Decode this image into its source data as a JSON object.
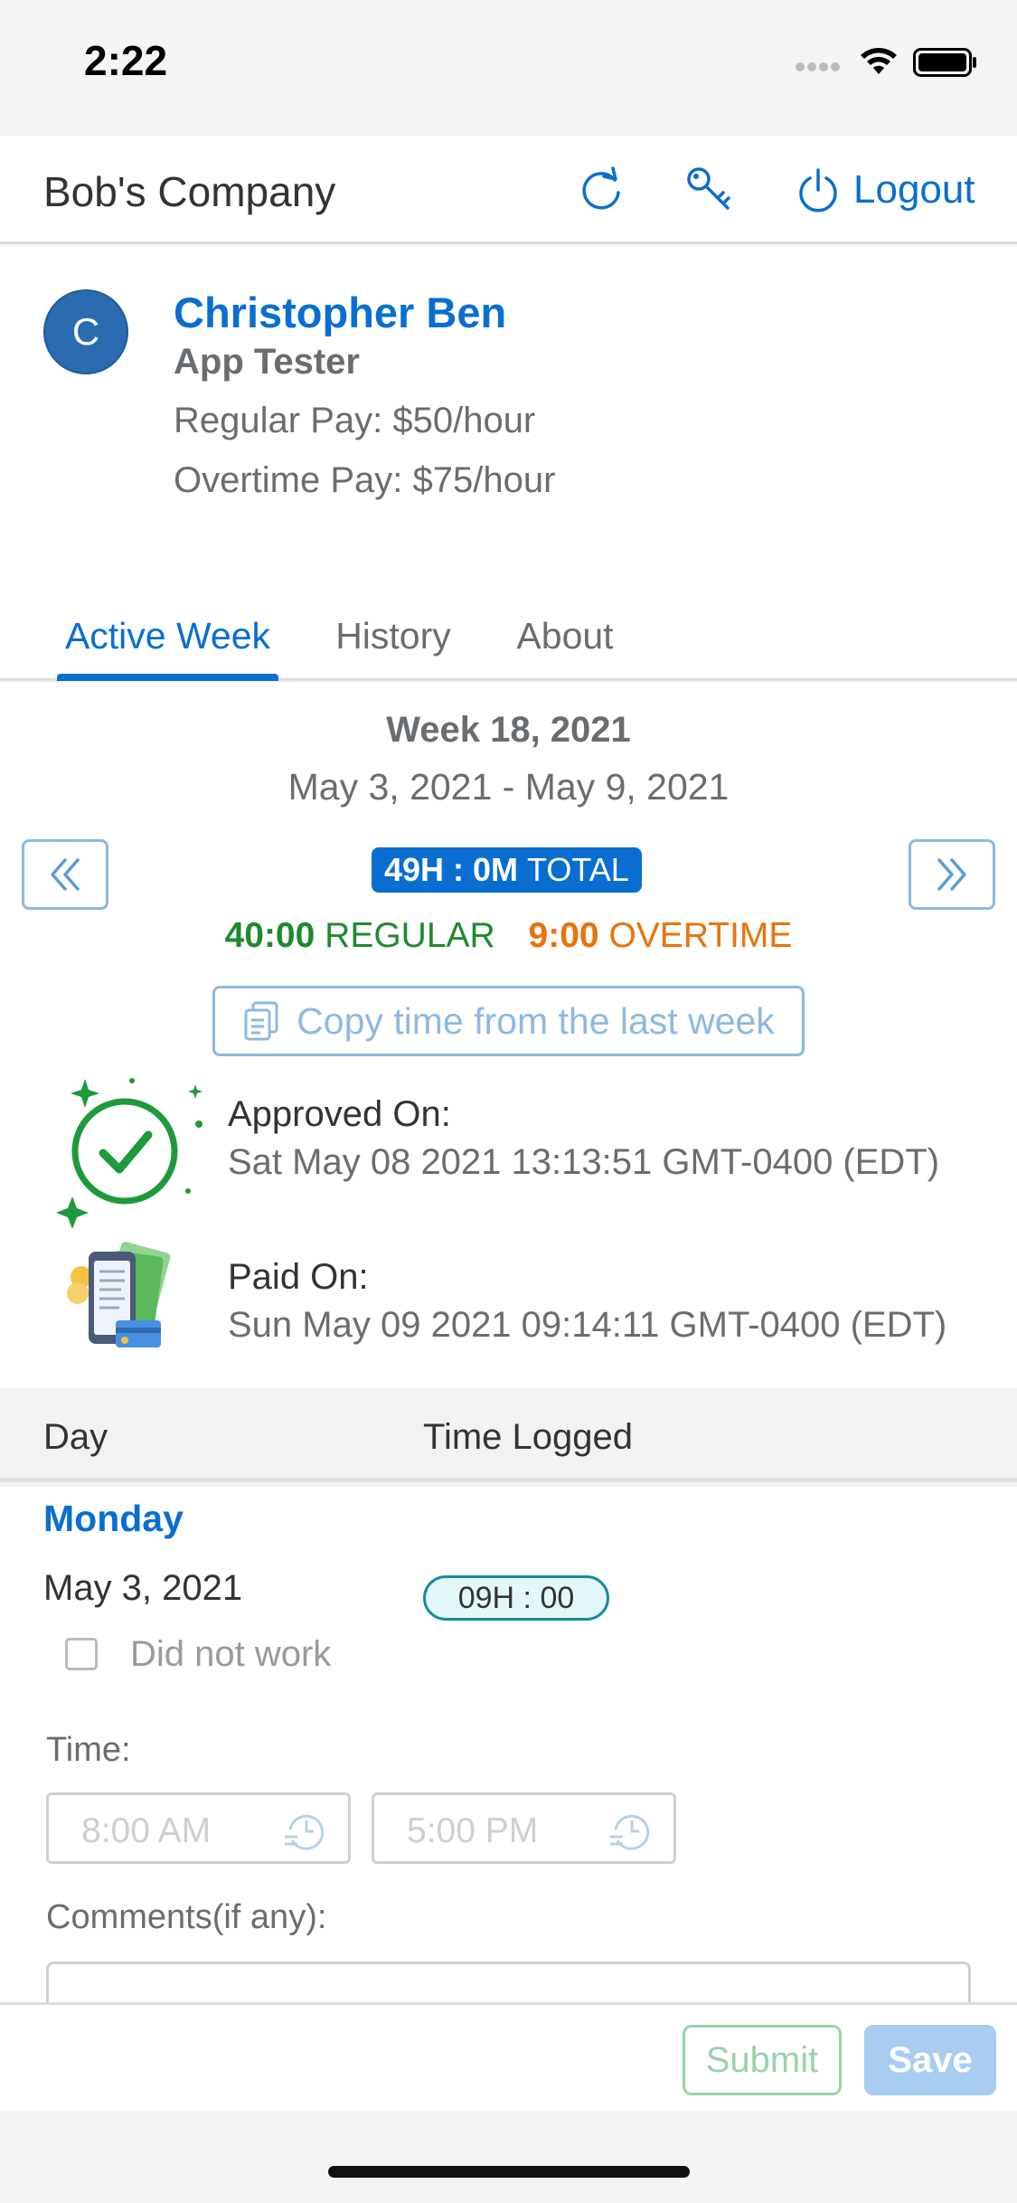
{
  "status_bar": {
    "time": "2:22"
  },
  "header": {
    "company": "Bob's Company",
    "logout_label": "Logout"
  },
  "profile": {
    "avatar_initial": "C",
    "name": "Christopher Ben",
    "role": "App Tester",
    "regular_pay": "Regular Pay: $50/hour",
    "overtime_pay": "Overtime Pay: $75/hour"
  },
  "tabs": [
    {
      "label": "Active Week",
      "active": true
    },
    {
      "label": "History",
      "active": false
    },
    {
      "label": "About",
      "active": false
    }
  ],
  "week": {
    "title": "Week 18, 2021",
    "range": "May 3, 2021 - May 9, 2021",
    "total_value": "49H : 0M",
    "total_label": "TOTAL",
    "regular_value": "40:00",
    "regular_label": "REGULAR",
    "overtime_value": "9:00",
    "overtime_label": "OVERTIME",
    "copy_label": "Copy time from the last week",
    "approved_label": "Approved On:",
    "approved_value": "Sat May 08 2021 13:13:51 GMT-0400 (EDT)",
    "paid_label": "Paid On:",
    "paid_value": "Sun May 09 2021 09:14:11 GMT-0400 (EDT)"
  },
  "table": {
    "col_day": "Day",
    "col_time": "Time Logged"
  },
  "day": {
    "name": "Monday",
    "date": "May 3, 2021",
    "logged": "09H : 00",
    "did_not_work": "Did not work",
    "time_label": "Time:",
    "start_time": "8:00 AM",
    "end_time": "5:00 PM",
    "comments_label": "Comments(if any):"
  },
  "footer": {
    "submit_label": "Submit",
    "save_label": "Save"
  },
  "colors": {
    "accent": "#0a6ed1",
    "regular": "#1e8a30",
    "overtime": "#e9730c"
  }
}
